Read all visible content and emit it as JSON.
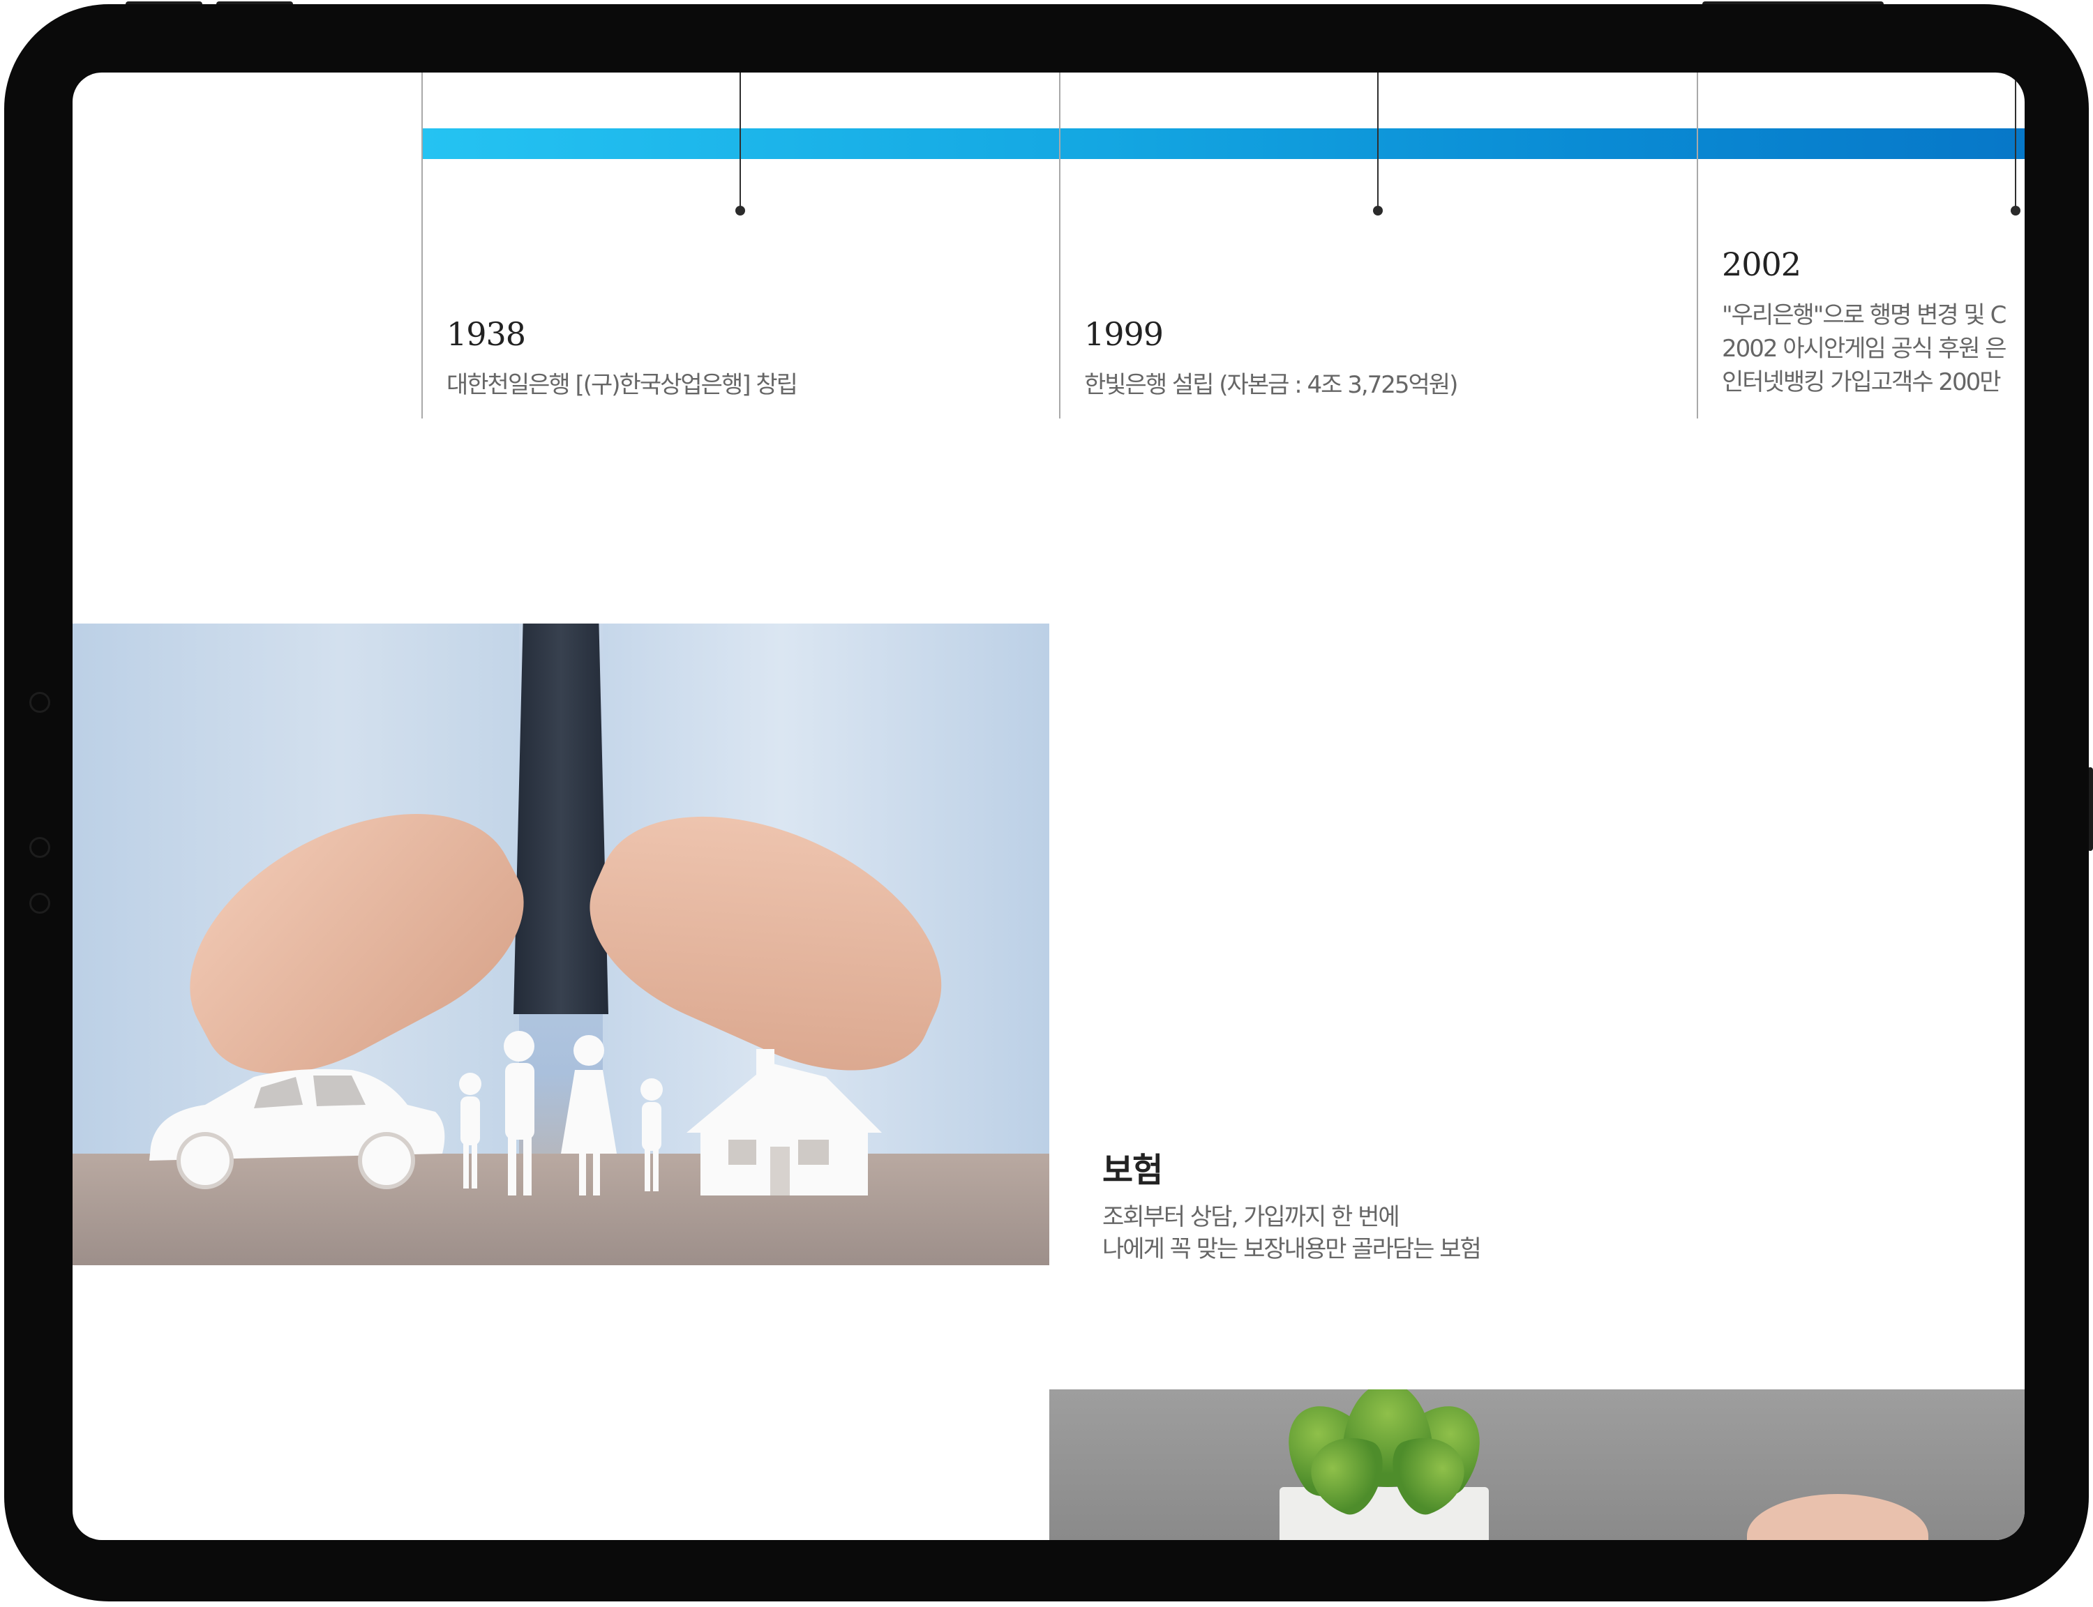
{
  "timeline": {
    "entries": [
      {
        "year": "1938",
        "lines": [
          "대한천일은행 [(구)한국상업은행] 창립"
        ]
      },
      {
        "year": "1999",
        "lines": [
          "한빛은행 설립 (자본금 : 4조 3,725억원)"
        ]
      },
      {
        "year": "2002",
        "lines": [
          "\"우리은행\"으로 행명 변경 및 C",
          "2002 아시안게임 공식 후원 은",
          "인터넷뱅킹 가입고객수 200만"
        ]
      }
    ],
    "colors": {
      "bar_start": "#25c3f2",
      "bar_end": "#0674c6"
    }
  },
  "insurance": {
    "title": "보험",
    "description": [
      "조회부터 상담, 가입까지 한 번에",
      "나에게 꼭 맞는 보장내용만 골라담는 보험"
    ]
  },
  "images": {
    "insurance_photo": "hands-protecting-family-car-house-paper-cutout",
    "plant_photo": "succulent-plant-in-white-pot"
  }
}
